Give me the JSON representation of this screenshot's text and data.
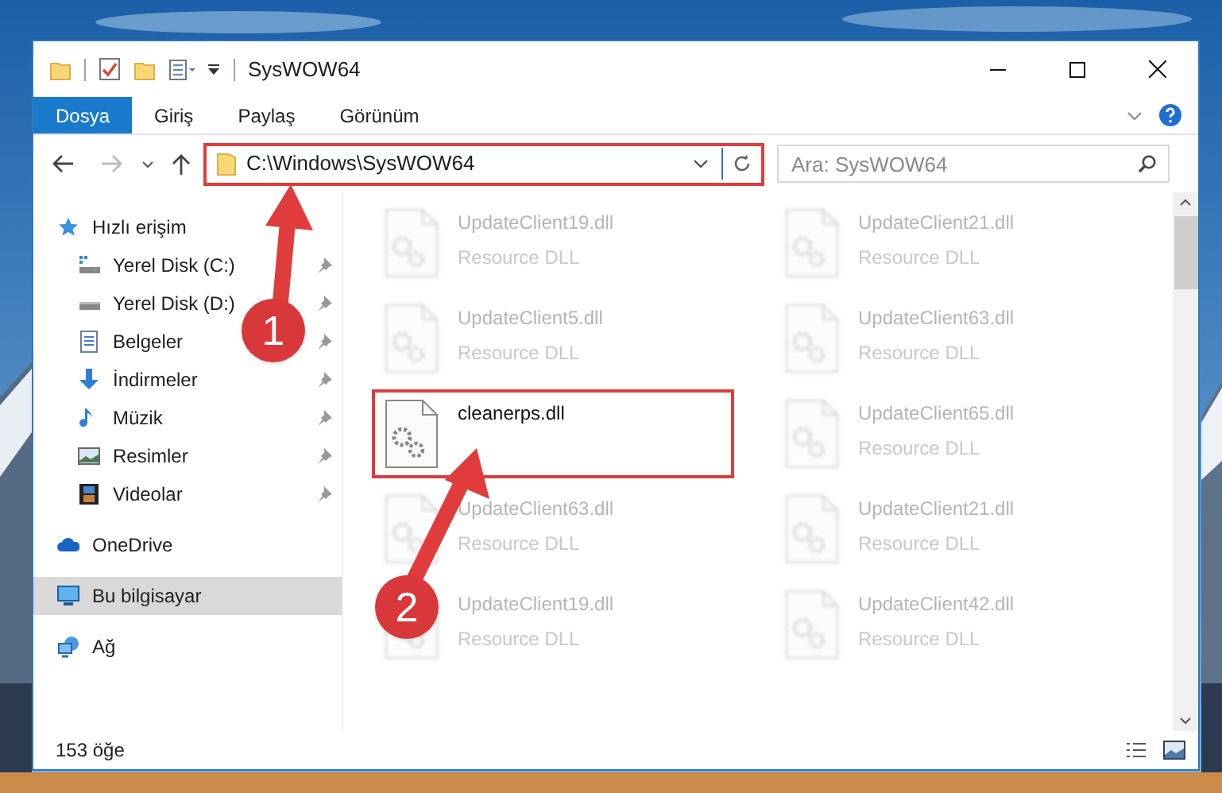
{
  "window": {
    "title": "SysWOW64"
  },
  "ribbon_tabs": [
    {
      "label": "Dosya",
      "selected": true
    },
    {
      "label": "Giriş",
      "selected": false
    },
    {
      "label": "Paylaş",
      "selected": false
    },
    {
      "label": "Görünüm",
      "selected": false
    }
  ],
  "address_bar": {
    "path": "C:\\Windows\\SysWOW64",
    "highlighted": true
  },
  "search": {
    "placeholder": "Ara: SysWOW64"
  },
  "sidebar": {
    "items": [
      {
        "label": "Hızlı erişim",
        "kind": "star",
        "selected": false,
        "children": [
          {
            "label": "Yerel Disk (C:)",
            "kind": "windrive",
            "pinned": true,
            "selected": false
          },
          {
            "label": "Yerel Disk (D:)",
            "kind": "drive",
            "pinned": true,
            "selected": false
          },
          {
            "label": "Belgeler",
            "kind": "docs",
            "pinned": true,
            "selected": false
          },
          {
            "label": "İndirmeler",
            "kind": "download",
            "pinned": true,
            "selected": false
          },
          {
            "label": "Müzik",
            "kind": "music",
            "pinned": true,
            "selected": false
          },
          {
            "label": "Resimler",
            "kind": "pictures",
            "pinned": true,
            "selected": false
          },
          {
            "label": "Videolar",
            "kind": "videos",
            "pinned": true,
            "selected": false
          }
        ]
      },
      {
        "label": "OneDrive",
        "kind": "cloud",
        "selected": false
      },
      {
        "label": "Bu bilgisayar",
        "kind": "pc",
        "selected": true
      },
      {
        "label": "Ağ",
        "kind": "network",
        "selected": false
      }
    ]
  },
  "files": [
    {
      "name": "UpdateClient19.dll",
      "type": "Resource DLL",
      "blurred": true,
      "highlighted": false
    },
    {
      "name": "UpdateClient21.dll",
      "type": "Resource DLL",
      "blurred": true,
      "highlighted": false
    },
    {
      "name": "UpdateClient5.dll",
      "type": "Resource DLL",
      "blurred": true,
      "highlighted": false
    },
    {
      "name": "UpdateClient63.dll",
      "type": "Resource DLL",
      "blurred": true,
      "highlighted": false
    },
    {
      "name": "cleanerps.dll",
      "blurred": false,
      "highlighted": true
    },
    {
      "name": "UpdateClient65.dll",
      "type": "Resource DLL",
      "blurred": true,
      "highlighted": false
    },
    {
      "name": "UpdateClient63.dll",
      "type": "Resource DLL",
      "blurred": true,
      "highlighted": false
    },
    {
      "name": "UpdateClient21.dll",
      "type": "Resource DLL",
      "blurred": true,
      "highlighted": false
    },
    {
      "name": "UpdateClient19.dll",
      "type": "Resource DLL",
      "blurred": true,
      "highlighted": false
    },
    {
      "name": "UpdateClient42.dll",
      "type": "Resource DLL",
      "blurred": true,
      "highlighted": false
    }
  ],
  "status_bar": {
    "count": "153 öğe"
  },
  "annotations": [
    {
      "label": "1"
    },
    {
      "label": "2"
    }
  ]
}
